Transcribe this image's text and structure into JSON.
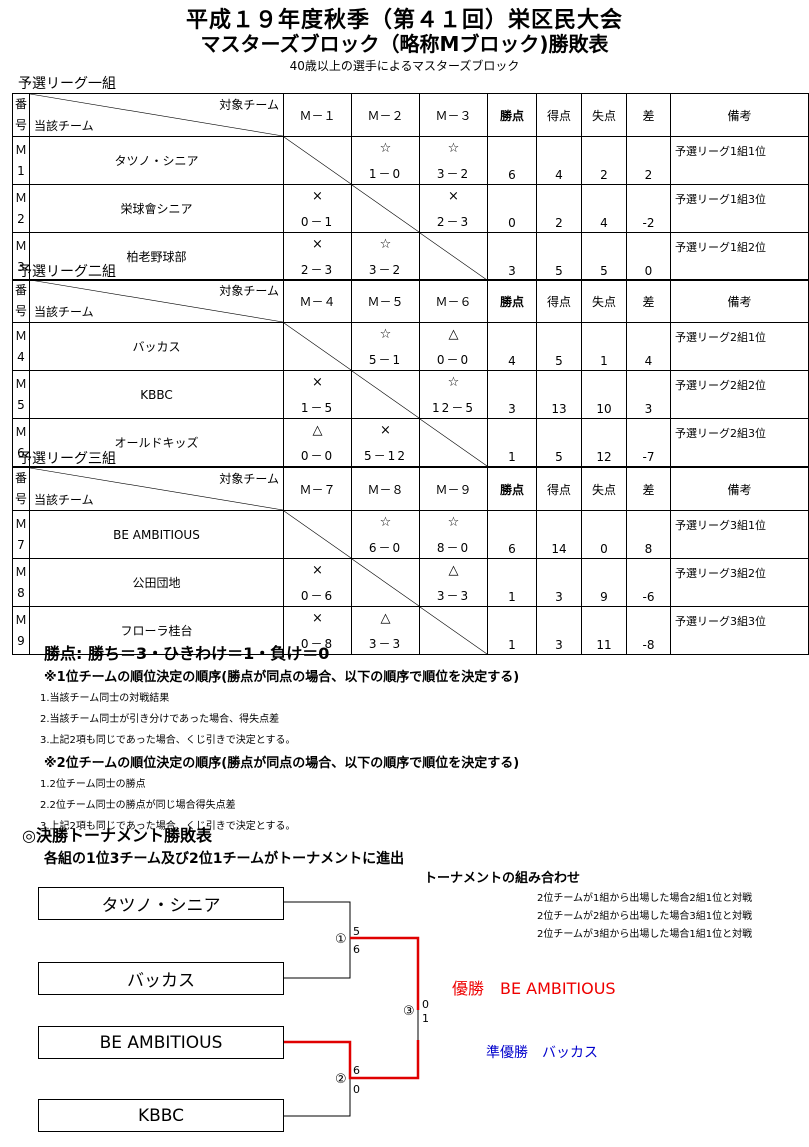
{
  "header": {
    "title": "平成１９年度秋季（第４１回）栄区民大会",
    "subtitle": "マスターズブロック（略称Mブロック)勝敗表",
    "caption": "40歳以上の選手によるマスターズブロック"
  },
  "table_headers": {
    "ban1": "番",
    "ban2": "号",
    "target": "対象チーム",
    "own": "当該チーム",
    "points": "勝点",
    "scored": "得点",
    "conceded": "失点",
    "diff": "差",
    "notes": "備考"
  },
  "groups": [
    {
      "label": "予選リーグ一組",
      "cols": [
        "Ｍ－１",
        "Ｍ－２",
        "Ｍ－３"
      ],
      "teams": [
        {
          "id_a": "Ｍ",
          "id_b": "1",
          "name": "タツノ・シニア",
          "r": [
            null,
            {
              "m": "☆",
              "s": "1－0"
            },
            {
              "m": "☆",
              "s": "3－2"
            }
          ],
          "pts": "6",
          "gf": "4",
          "ga": "2",
          "diff": "2",
          "note": "予選リーグ1組1位"
        },
        {
          "id_a": "Ｍ",
          "id_b": "2",
          "name": "栄球會シニア",
          "r": [
            {
              "m": "×",
              "s": "0－1"
            },
            null,
            {
              "m": "×",
              "s": "2－3"
            }
          ],
          "pts": "0",
          "gf": "2",
          "ga": "4",
          "diff": "-2",
          "note": "予選リーグ1組3位"
        },
        {
          "id_a": "Ｍ",
          "id_b": "3",
          "name": "柏老野球部",
          "r": [
            {
              "m": "×",
              "s": "2－3"
            },
            {
              "m": "☆",
              "s": "3－2"
            },
            null
          ],
          "pts": "3",
          "gf": "5",
          "ga": "5",
          "diff": "0",
          "note": "予選リーグ1組2位"
        }
      ]
    },
    {
      "label": "予選リーグ二組",
      "cols": [
        "Ｍ－４",
        "Ｍ－５",
        "Ｍ－６"
      ],
      "teams": [
        {
          "id_a": "Ｍ",
          "id_b": "4",
          "name": "バッカス",
          "r": [
            null,
            {
              "m": "☆",
              "s": "5－1"
            },
            {
              "m": "△",
              "s": "0－0"
            }
          ],
          "pts": "4",
          "gf": "5",
          "ga": "1",
          "diff": "4",
          "note": "予選リーグ2組1位"
        },
        {
          "id_a": "Ｍ",
          "id_b": "5",
          "name": "KBBC",
          "r": [
            {
              "m": "×",
              "s": "1－5"
            },
            null,
            {
              "m": "☆",
              "s": "12－5"
            }
          ],
          "pts": "3",
          "gf": "13",
          "ga": "10",
          "diff": "3",
          "note": "予選リーグ2組2位"
        },
        {
          "id_a": "Ｍ",
          "id_b": "6",
          "name": "オールドキッズ",
          "r": [
            {
              "m": "△",
              "s": "0－0"
            },
            {
              "m": "×",
              "s": "5－12"
            },
            null
          ],
          "pts": "1",
          "gf": "5",
          "ga": "12",
          "diff": "-7",
          "note": "予選リーグ2組3位"
        }
      ]
    },
    {
      "label": "予選リーグ三組",
      "cols": [
        "Ｍ－７",
        "Ｍ－８",
        "Ｍ－９"
      ],
      "teams": [
        {
          "id_a": "Ｍ",
          "id_b": "7",
          "name": "BE AMBITIOUS",
          "r": [
            null,
            {
              "m": "☆",
              "s": "6－0"
            },
            {
              "m": "☆",
              "s": "8－0"
            }
          ],
          "pts": "6",
          "gf": "14",
          "ga": "0",
          "diff": "8",
          "note": "予選リーグ3組1位"
        },
        {
          "id_a": "Ｍ",
          "id_b": "8",
          "name": "公田団地",
          "r": [
            {
              "m": "×",
              "s": "0－6"
            },
            null,
            {
              "m": "△",
              "s": "3－3"
            }
          ],
          "pts": "1",
          "gf": "3",
          "ga": "9",
          "diff": "-6",
          "note": "予選リーグ3組2位"
        },
        {
          "id_a": "Ｍ",
          "id_b": "9",
          "name": "フローラ桂台",
          "r": [
            {
              "m": "×",
              "s": "0－8"
            },
            {
              "m": "△",
              "s": "3－3"
            },
            null
          ],
          "pts": "1",
          "gf": "3",
          "ga": "11",
          "diff": "-8",
          "note": "予選リーグ3組3位"
        }
      ]
    }
  ],
  "rules": {
    "points": "勝点: 勝ち＝3・ひきわけ＝1・負け＝0",
    "first_heading": "※1位チームの順位決定の順序(勝点が同点の場合、以下の順序で順位を決定する)",
    "first_items": [
      "1.当該チーム同士の対戦結果",
      "2.当該チーム同士が引き分けであった場合、得失点差",
      "3.上記2項も同じであった場合、くじ引きで決定とする。"
    ],
    "second_heading": "※2位チームの順位決定の順序(勝点が同点の場合、以下の順序で順位を決定する)",
    "second_items": [
      "1.2位チーム同士の勝点",
      "2.2位チーム同士の勝点が同じ場合得失点差",
      "3.上記2項も同じであった場合、くじ引きで決定とする。"
    ]
  },
  "tournament": {
    "title": "◎決勝トーナメント勝敗表",
    "subtitle": "各組の1位3チーム及び2位1チームがトーナメントに進出",
    "combo_title": "トーナメントの組み合わせ",
    "conditions": [
      "2位チームが1組から出場した場合2組1位と対戦",
      "2位チームが2組から出場した場合3組1位と対戦",
      "2位チームが3組から出場した場合1組1位と対戦"
    ],
    "teams": [
      "タツノ・シニア",
      "バッカス",
      "BE AMBITIOUS",
      "KBBC"
    ],
    "match1": {
      "label": "①",
      "top": "5",
      "bottom": "6"
    },
    "match2": {
      "label": "②",
      "top": "6",
      "bottom": "0"
    },
    "match3": {
      "label": "③",
      "top": "0",
      "bottom": "1"
    },
    "champion": "優勝　BE AMBITIOUS",
    "runner_up": "準優勝　バッカス",
    "colors": {
      "win_line": "#e00000",
      "champion": "#e00000",
      "runner_up": "#0000cc"
    }
  }
}
